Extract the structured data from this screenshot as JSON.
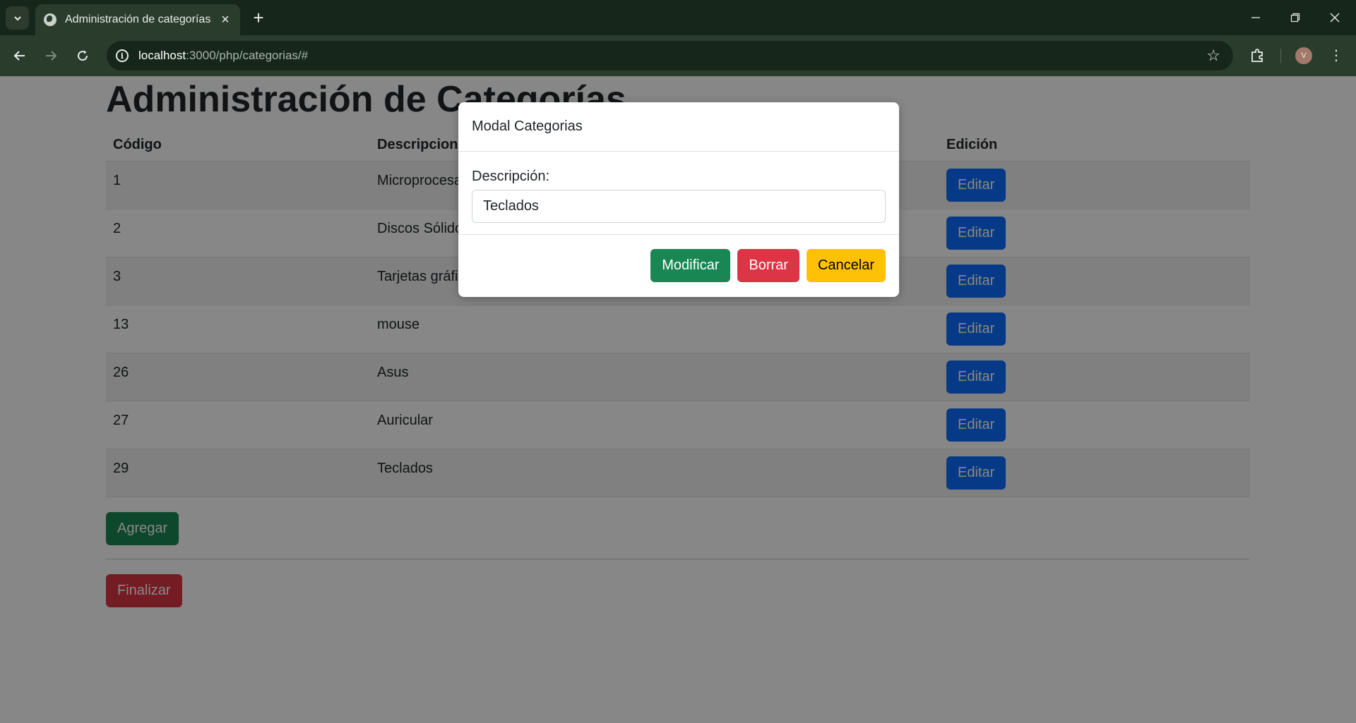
{
  "browser": {
    "tab_title": "Administración de categorías",
    "url_host": "localhost",
    "url_path": ":3000/php/categorias/#",
    "avatar_letter": "V"
  },
  "page": {
    "heading": "Administración de Categorías",
    "columns": [
      "Código",
      "Descripcion",
      "Edición"
    ],
    "rows": [
      {
        "code": "1",
        "description": "Microprocesadores",
        "action": "Editar"
      },
      {
        "code": "2",
        "description": "Discos Sólidos",
        "action": "Editar"
      },
      {
        "code": "3",
        "description": "Tarjetas gráficas",
        "action": "Editar"
      },
      {
        "code": "13",
        "description": "mouse",
        "action": "Editar"
      },
      {
        "code": "26",
        "description": "Asus",
        "action": "Editar"
      },
      {
        "code": "27",
        "description": "Auricular",
        "action": "Editar"
      },
      {
        "code": "29",
        "description": "Teclados",
        "action": "Editar"
      }
    ],
    "add_label": "Agregar",
    "finish_label": "Finalizar"
  },
  "modal": {
    "title": "Modal Categorias",
    "field_label": "Descripción:",
    "field_value": "Teclados",
    "modify_label": "Modificar",
    "delete_label": "Borrar",
    "cancel_label": "Cancelar"
  }
}
